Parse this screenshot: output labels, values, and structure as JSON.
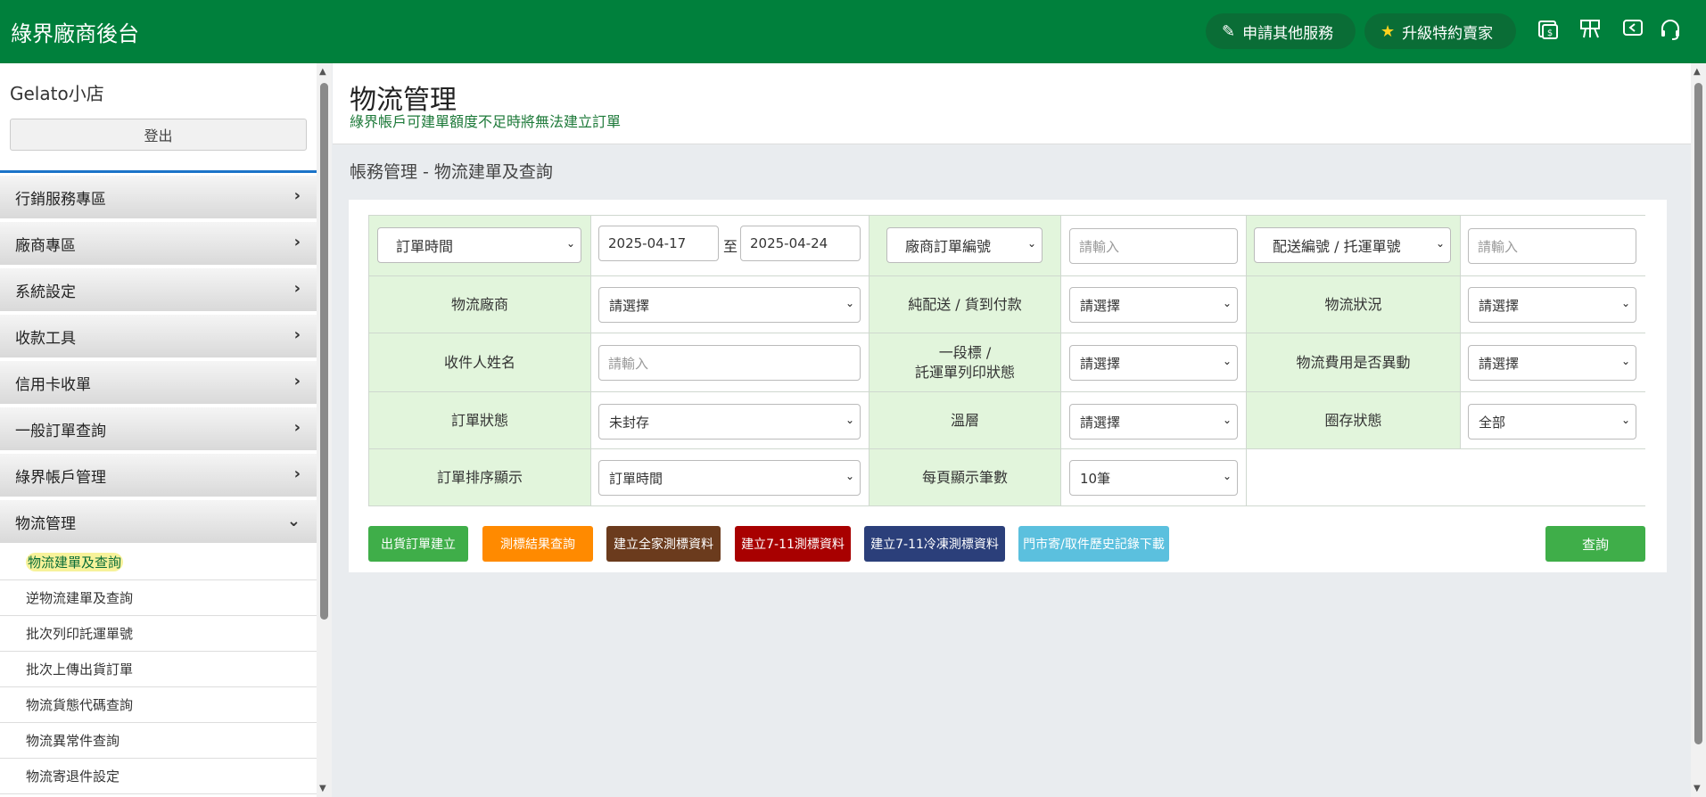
{
  "header": {
    "brand": "綠界廠商後台",
    "apply_service": "申請其他服務",
    "upgrade": "升級特約賣家",
    "icons": [
      "invoice-icon",
      "store-icon",
      "back-icon",
      "headset-icon"
    ]
  },
  "sidebar": {
    "shop_name": "Gelato小店",
    "logout": "登出",
    "menu": [
      {
        "label": "行銷服務專區"
      },
      {
        "label": "廠商專區"
      },
      {
        "label": "系統設定"
      },
      {
        "label": "收款工具"
      },
      {
        "label": "信用卡收單"
      },
      {
        "label": "一般訂單查詢"
      },
      {
        "label": "綠界帳戶管理"
      },
      {
        "label": "物流管理"
      }
    ],
    "submenu": [
      {
        "label": "物流建單及查詢"
      },
      {
        "label": "逆物流建單及查詢"
      },
      {
        "label": "批次列印託運單號"
      },
      {
        "label": "批次上傳出貨訂單"
      },
      {
        "label": "物流貨態代碼查詢"
      },
      {
        "label": "物流異常件查詢"
      },
      {
        "label": "物流寄退件設定"
      }
    ]
  },
  "main": {
    "title": "物流管理",
    "notice": "綠界帳戶可建單額度不足時將無法建立訂單",
    "breadcrumb": "帳務管理 - 物流建單及查詢"
  },
  "search": {
    "date_type": "訂單時間",
    "date_from": "2025-04-17",
    "date_to_sep": "至",
    "date_to": "2025-04-24",
    "order_no_type": "廠商訂單編號",
    "order_no_placeholder": "請輸入",
    "ship_no_type": "配送編號 / 托運單號",
    "ship_no_placeholder": "請輸入",
    "logistics_vendor_label": "物流廠商",
    "logistics_vendor_value": "請選擇",
    "pure_delivery_label": "純配送 / 貨到付款",
    "pure_delivery_value": "請選擇",
    "logistics_status_label": "物流狀況",
    "logistics_status_value": "請選擇",
    "receiver_label": "收件人姓名",
    "receiver_placeholder": "請輸入",
    "print_status_label_1": "一段標 /",
    "print_status_label_2": "託運單列印狀態",
    "print_status_value": "請選擇",
    "fee_change_label": "物流費用是否異動",
    "fee_change_value": "請選擇",
    "order_status_label": "訂單狀態",
    "order_status_value": "未封存",
    "temp_label": "溫層",
    "temp_value": "請選擇",
    "archive_label": "圈存狀態",
    "archive_value": "全部",
    "sort_label": "訂單排序顯示",
    "sort_value": "訂單時間",
    "per_page_label": "每頁顯示筆數",
    "per_page_value": "10筆"
  },
  "buttons": {
    "create_order": "出貨訂單建立",
    "test_result": "測標結果查詢",
    "family_test": "建立全家測標資料",
    "seven_test": "建立7-11測標資料",
    "seven_frozen_test": "建立7-11冷凍測標資料",
    "store_history": "門市寄/取件歷史記錄下載",
    "query": "查詢"
  },
  "colors": {
    "brand_green": "#00803c",
    "label_bg": "#e2f5dc"
  }
}
